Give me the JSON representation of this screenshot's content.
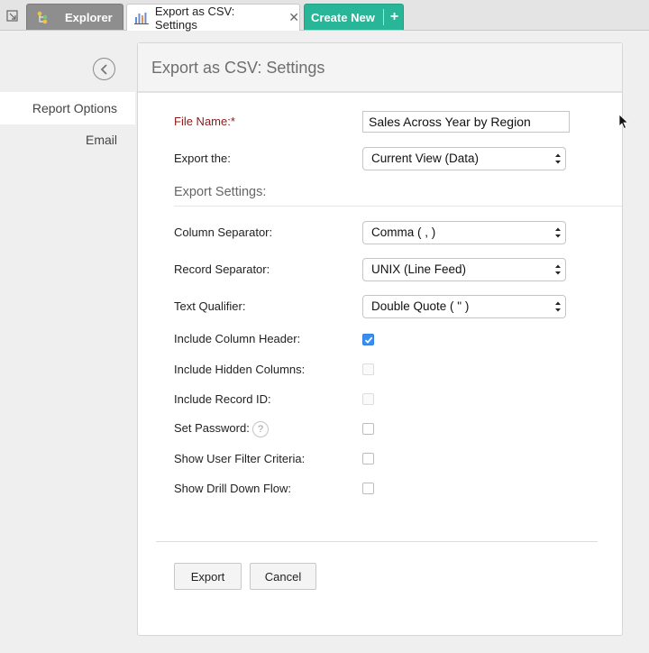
{
  "tabs": [
    {
      "label": "Explorer",
      "icon": "explorer-tree-icon"
    },
    {
      "label": "Export as CSV: Settings",
      "icon": "bar-chart-icon",
      "close": "✕"
    },
    {
      "label": "Create New",
      "plus": "+"
    }
  ],
  "nav": {
    "items": [
      {
        "label": "Report Options",
        "active": true
      },
      {
        "label": "Email",
        "active": false
      }
    ]
  },
  "panel": {
    "title": "Export as CSV: Settings"
  },
  "form": {
    "file_name_label": "File Name:*",
    "file_name_value": "Sales Across Year by Region",
    "export_the_label": "Export the:",
    "export_the_value": "Current View (Data)",
    "section_title": "Export Settings:",
    "column_separator_label": "Column Separator:",
    "column_separator_value": "Comma ( , )",
    "record_separator_label": "Record Separator:",
    "record_separator_value": "UNIX (Line Feed)",
    "text_qualifier_label": "Text Qualifier:",
    "text_qualifier_value": "Double Quote ( \" )",
    "include_column_header_label": "Include Column Header:",
    "include_hidden_columns_label": "Include Hidden Columns:",
    "include_record_id_label": "Include Record ID:",
    "set_password_label": "Set Password:",
    "help_glyph": "?",
    "show_user_filter_label": "Show User Filter Criteria:",
    "show_drill_down_label": "Show Drill Down Flow:"
  },
  "checkbox_states": {
    "include_column_header": true,
    "include_hidden_columns": false,
    "include_record_id": false,
    "set_password": false,
    "show_user_filter_criteria": false,
    "show_drill_down_flow": false
  },
  "buttons": {
    "export": "Export",
    "cancel": "Cancel"
  },
  "colors": {
    "accent_green": "#29b597",
    "checkbox_blue": "#3b8ef0",
    "required_red": "#8b1a1a"
  }
}
